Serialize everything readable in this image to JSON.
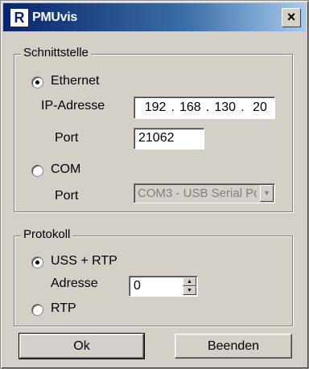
{
  "window": {
    "title": "PMUvis",
    "icon_letter": "R",
    "close_glyph": "×"
  },
  "interface_group": {
    "title": "Schnittstelle",
    "ethernet": {
      "label": "Ethernet",
      "selected": true,
      "ip_label": "IP-Adresse",
      "ip_octets": [
        "192",
        "168",
        "130",
        "20"
      ],
      "port_label": "Port",
      "port_value": "21062"
    },
    "com": {
      "label": "COM",
      "selected": false,
      "port_label": "Port",
      "port_value": "COM3 - USB Serial Pc",
      "arrow": "▼"
    }
  },
  "protocol_group": {
    "title": "Protokoll",
    "uss_rtp": {
      "label": "USS + RTP",
      "selected": true,
      "address_label": "Adresse",
      "address_value": "0",
      "spin_up": "▲",
      "spin_down": "▼"
    },
    "rtp": {
      "label": "RTP",
      "selected": false
    }
  },
  "buttons": {
    "ok": "Ok",
    "quit": "Beenden"
  }
}
